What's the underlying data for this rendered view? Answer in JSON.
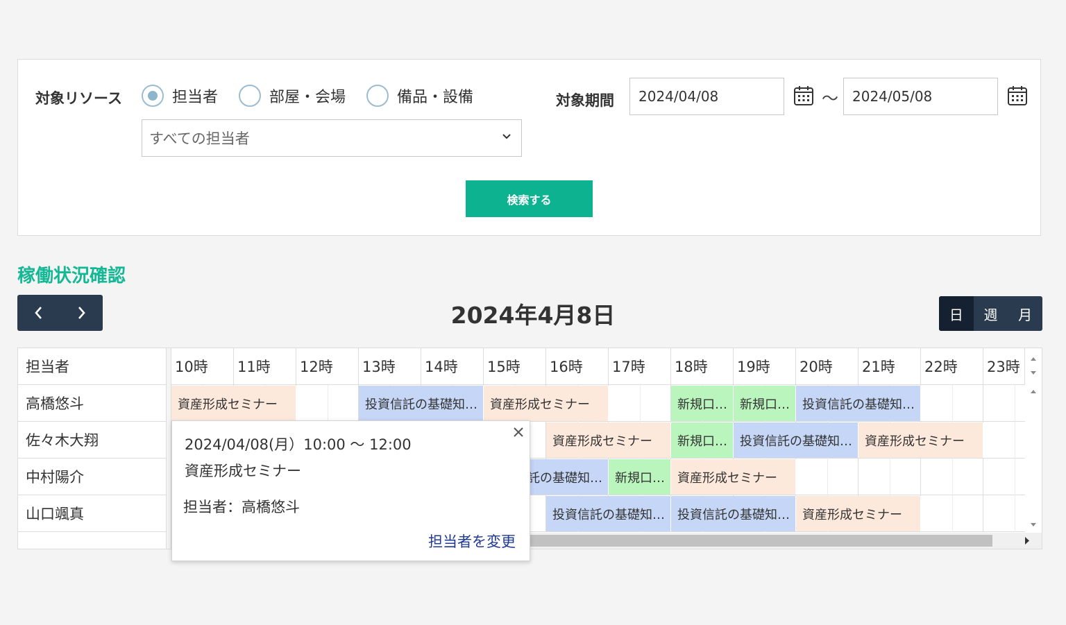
{
  "search": {
    "resource_label": "対象リソース",
    "radio_options": [
      "担当者",
      "部屋・会場",
      "備品・設備"
    ],
    "selected_radio": "担当者",
    "staff_select_value": "すべての担当者",
    "period_label": "対象期間",
    "date_from": "2024/04/08",
    "date_separator": "〜",
    "date_to": "2024/05/08",
    "search_button": "検索する"
  },
  "schedule": {
    "section_title": "稼働状況確認",
    "date_heading": "2024年4月8日",
    "views": [
      "日",
      "週",
      "月"
    ],
    "active_view": "日",
    "resource_header": "担当者",
    "hours": [
      "10時",
      "11時",
      "12時",
      "13時",
      "14時",
      "15時",
      "16時",
      "17時",
      "18時",
      "19時",
      "20時",
      "21時",
      "22時",
      "23時"
    ],
    "staff": [
      "高橋悠斗",
      "佐々木大翔",
      "中村陽介",
      "山口颯真"
    ],
    "events": [
      {
        "row": 0,
        "start": 10,
        "end": 12,
        "title": "資産形成セミナー",
        "color": "peach"
      },
      {
        "row": 0,
        "start": 13,
        "end": 15,
        "title": "投資信託の基礎知…",
        "color": "blue"
      },
      {
        "row": 0,
        "start": 15,
        "end": 17,
        "title": "資産形成セミナー",
        "color": "peach"
      },
      {
        "row": 0,
        "start": 18,
        "end": 19,
        "title": "新規口…",
        "color": "green"
      },
      {
        "row": 0,
        "start": 19,
        "end": 20,
        "title": "新規口…",
        "color": "green"
      },
      {
        "row": 0,
        "start": 20,
        "end": 22,
        "title": "投資信託の基礎知…",
        "color": "blue"
      },
      {
        "row": 1,
        "start": 16,
        "end": 18,
        "title": "資産形成セミナー",
        "color": "peach"
      },
      {
        "row": 1,
        "start": 18,
        "end": 19,
        "title": "新規口…",
        "color": "green"
      },
      {
        "row": 1,
        "start": 19,
        "end": 21,
        "title": "投資信託の基礎知…",
        "color": "blue"
      },
      {
        "row": 1,
        "start": 21,
        "end": 23,
        "title": "資産形成セミナー",
        "color": "peach"
      },
      {
        "row": 2,
        "start": 15,
        "end": 17,
        "title": "投資信託の基礎知…",
        "color": "blue"
      },
      {
        "row": 2,
        "start": 17,
        "end": 18,
        "title": "新規口…",
        "color": "green"
      },
      {
        "row": 2,
        "start": 18,
        "end": 20,
        "title": "資産形成セミナー",
        "color": "peach"
      },
      {
        "row": 3,
        "start": 16,
        "end": 18,
        "title": "投資信託の基礎知…",
        "color": "blue"
      },
      {
        "row": 3,
        "start": 18,
        "end": 20,
        "title": "投資信託の基礎知…",
        "color": "blue"
      },
      {
        "row": 3,
        "start": 20,
        "end": 22,
        "title": "資産形成セミナー",
        "color": "peach"
      }
    ]
  },
  "popup": {
    "datetime": "2024/04/08(月）10:00 〜 12:00",
    "title": "資産形成セミナー",
    "staff": "担当者：高橋悠斗",
    "change_link": "担当者を変更"
  },
  "colors": {
    "accent": "#0db391",
    "navy": "#2a3a4f",
    "peach": "#fde9dc",
    "blue": "#c6d6f6",
    "green": "#b9f5bc",
    "link": "#1f3a93"
  }
}
